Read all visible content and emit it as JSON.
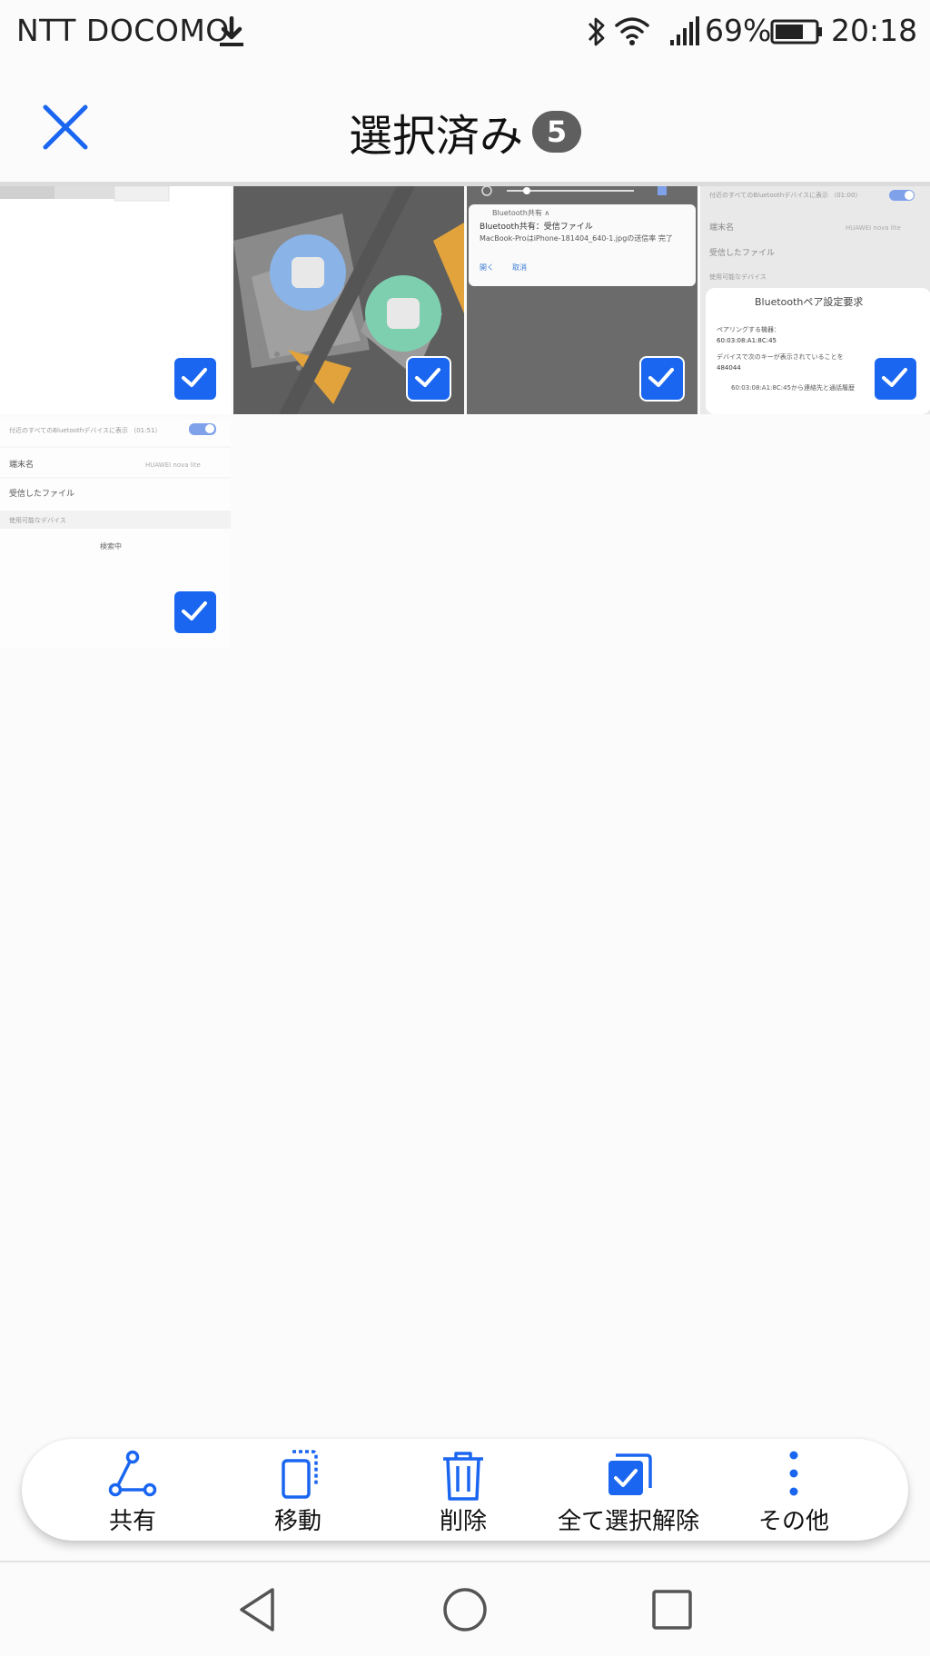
{
  "status_bar": {
    "carrier": "NTT DOCOMO",
    "battery": "69%",
    "time": "20:18"
  },
  "header": {
    "title": "選択済み",
    "count": "5"
  },
  "thumbnails": [
    {
      "name": "screenshot-blank",
      "selected": true
    },
    {
      "name": "android-wallpaper",
      "selected": true
    },
    {
      "name": "bluetooth-notification",
      "selected": true
    },
    {
      "name": "bluetooth-pairing-dialog",
      "selected": true
    },
    {
      "name": "bluetooth-settings",
      "selected": true
    }
  ],
  "thumb_text": {
    "notif_header": "Bluetooth共有 ∧",
    "notif_title": "Bluetooth共有：受信ファイル",
    "notif_body": "MacBook-ProはiPhone-181404_640-1.jpgの送信率 完了",
    "notif_action1": "開く",
    "notif_action2": "取消",
    "s4_top": "付近のすべてのBluetoothデバイスに表示 （01:00）",
    "s4_row1": "端末名",
    "s4_row1_val": "HUAWEI nova lite",
    "s4_row2": "受信したファイル",
    "s4_section": "使用可能なデバイス",
    "s4_dialog_title": "Bluetoothペア設定要求",
    "s4_dialog_l1": "ペアリングする機器：",
    "s4_dialog_l2": "60:03:08:A1:8C:45",
    "s4_dialog_l3": "デバイスで次のキーが表示されていることを",
    "s4_dialog_l4": "484044",
    "s4_dialog_l5": "60:03:08:A1:8C:45から連絡先と通話履歴",
    "s5_top": "付近のすべてのBluetoothデバイスに表示 （01:51）",
    "s5_row1": "端末名",
    "s5_row1_val": "HUAWEI nova lite",
    "s5_row2": "受信したファイル",
    "s5_section": "使用可能なデバイス",
    "s5_searching": "検索中"
  },
  "actions": {
    "share": "共有",
    "move": "移動",
    "delete": "削除",
    "deselect_all": "全て選択解除",
    "more": "その他"
  },
  "colors": {
    "accent": "#1a66f0",
    "badge": "#5f5f5f"
  }
}
